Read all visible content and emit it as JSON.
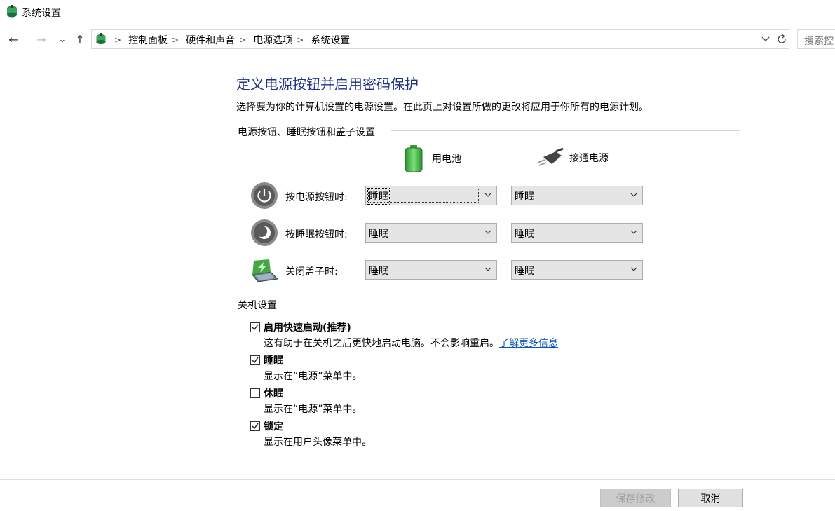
{
  "window": {
    "title": "系统设置",
    "icon": "power-options-icon"
  },
  "nav": {
    "back": "←",
    "forward": "→",
    "recent": "⌄",
    "up": "↑",
    "breadcrumb": [
      "控制面板",
      "硬件和声音",
      "电源选项",
      "系统设置"
    ],
    "search_placeholder": "搜索控"
  },
  "page": {
    "title": "定义电源按钮并启用密码保护",
    "description": "选择要为你的计算机设置的电源设置。在此页上对设置所做的更改将应用于你所有的电源计划。"
  },
  "buttons_section": {
    "heading": "电源按钮、睡眠按钮和盖子设置",
    "columns": [
      "用电池",
      "接通电源"
    ],
    "rows": [
      {
        "label": "按电源按钮时:",
        "icon": "power-button-icon",
        "battery": "睡眠",
        "plugged": "睡眠"
      },
      {
        "label": "按睡眠按钮时:",
        "icon": "sleep-button-icon",
        "battery": "睡眠",
        "plugged": "睡眠"
      },
      {
        "label": "关闭盖子时:",
        "icon": "laptop-lid-icon",
        "battery": "睡眠",
        "plugged": "睡眠"
      }
    ]
  },
  "shutdown_section": {
    "heading": "关机设置",
    "items": [
      {
        "title": "启用快速启动(推荐)",
        "desc": "这有助于在关机之后更快地启动电脑。不会影响重启。",
        "link": "了解更多信息",
        "checked": true
      },
      {
        "title": "睡眠",
        "desc": "显示在“电源”菜单中。",
        "checked": true
      },
      {
        "title": "休眠",
        "desc": "显示在“电源”菜单中。",
        "checked": false
      },
      {
        "title": "锁定",
        "desc": "显示在用户头像菜单中。",
        "checked": true
      }
    ]
  },
  "footer": {
    "save": "保存修改",
    "cancel": "取消"
  },
  "colors": {
    "heading": "#1e3287",
    "link": "#0b57b5",
    "battery": "#3fb33f"
  }
}
